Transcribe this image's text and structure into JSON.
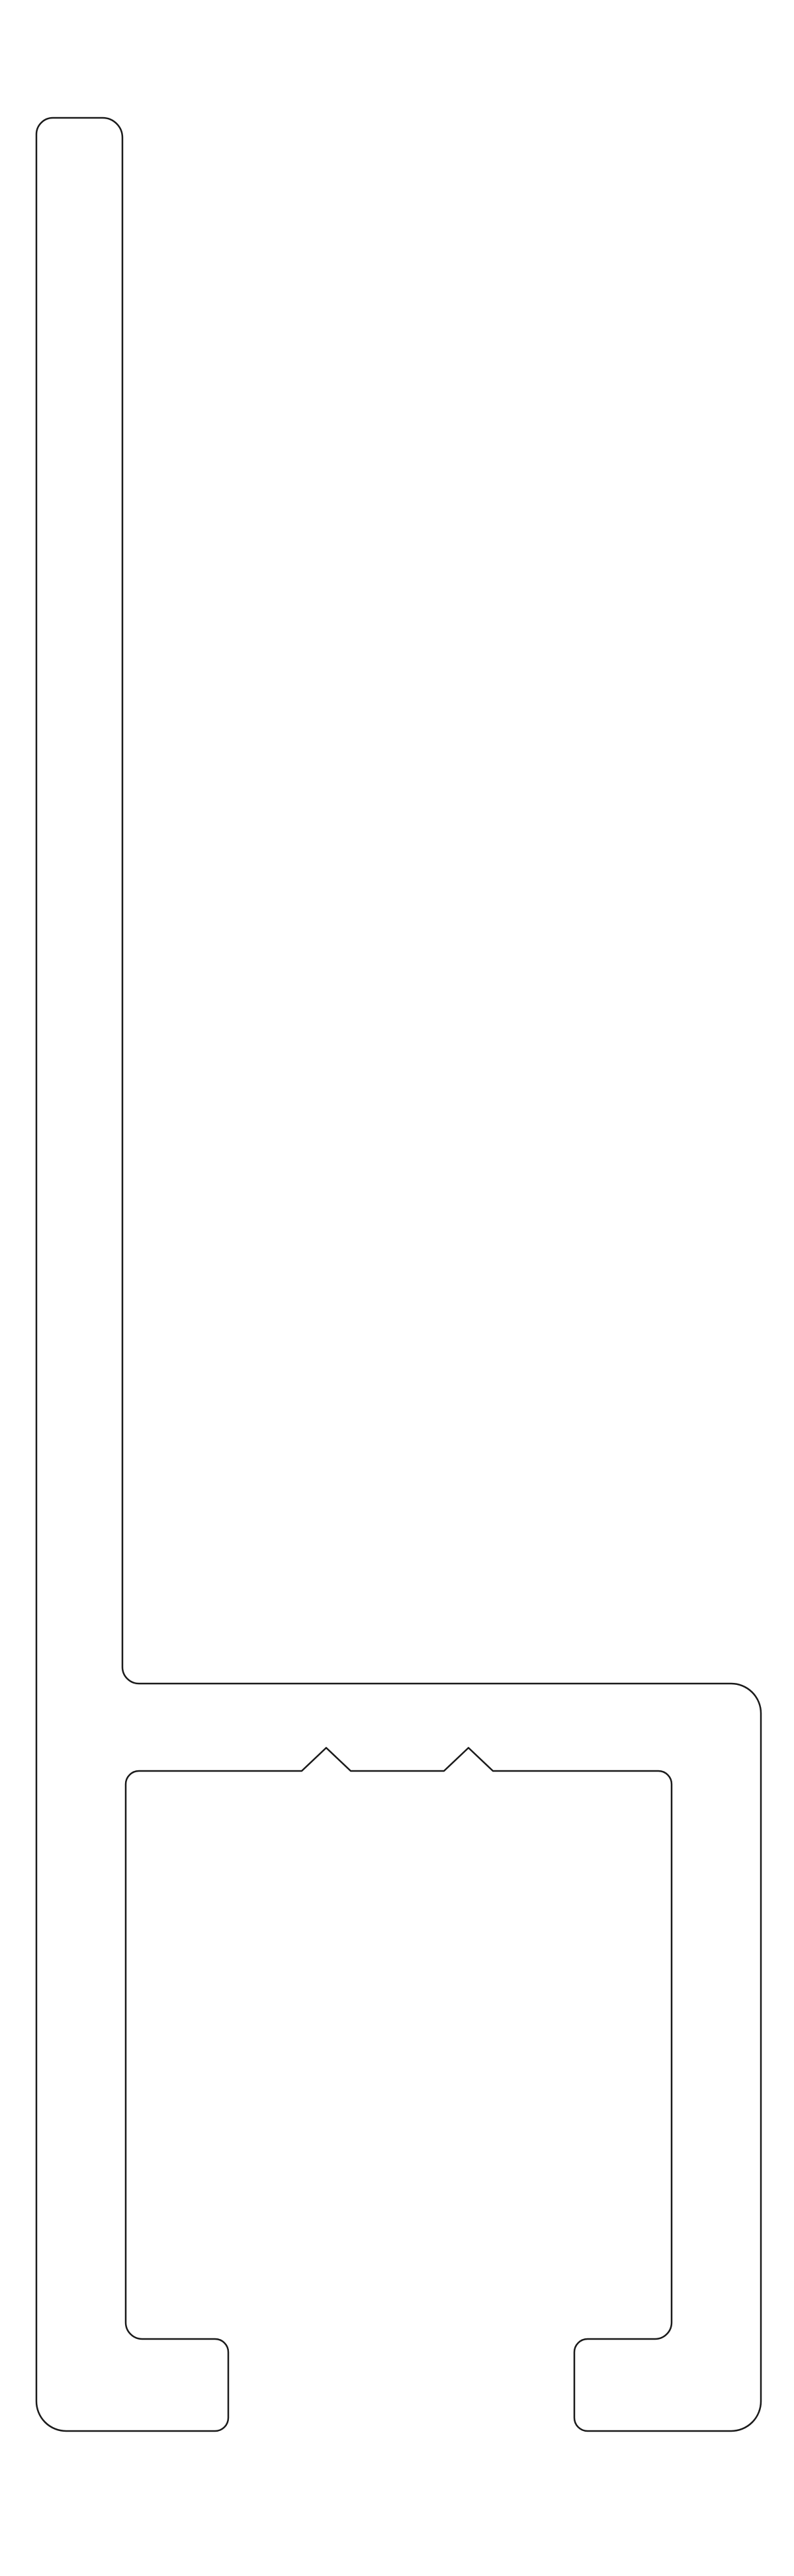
{
  "drawing": {
    "kind": "extrusion-profile-cross-section",
    "background_color": "#ffffff",
    "stroke_color": "#1a1a1a",
    "labels": []
  }
}
